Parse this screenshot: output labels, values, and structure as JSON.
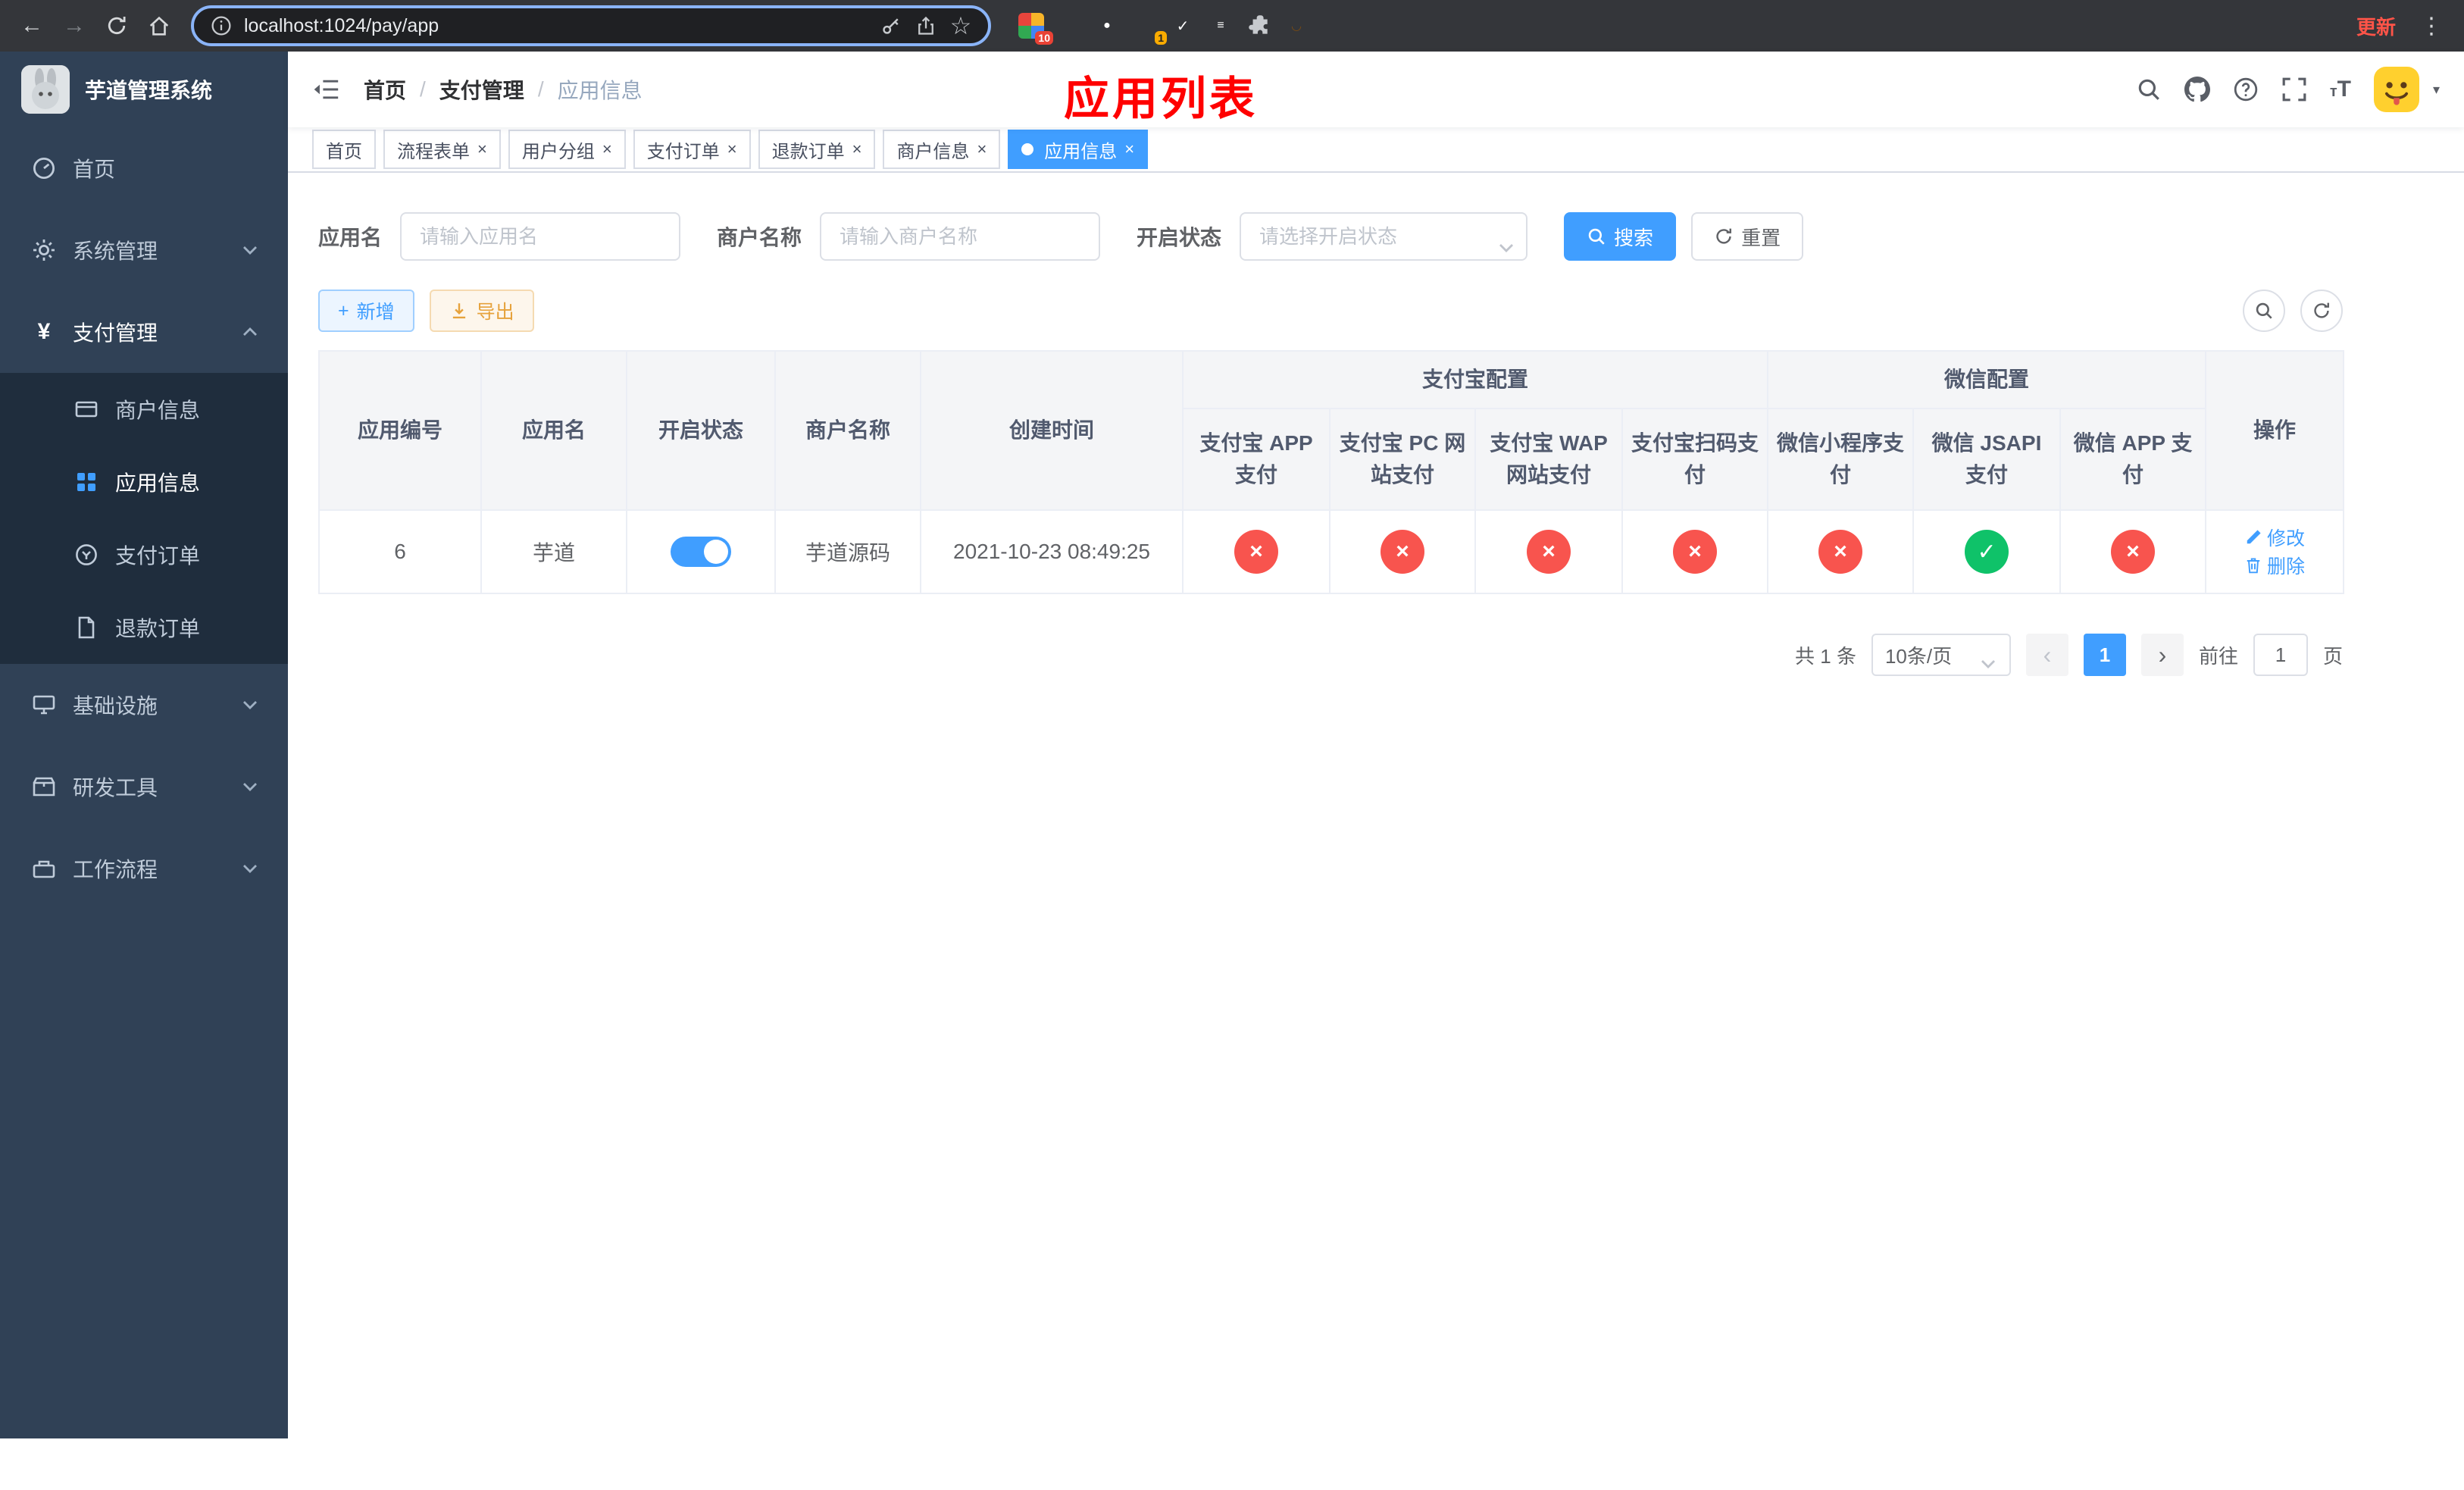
{
  "browser": {
    "url": "localhost:1024/pay/app",
    "update_label": "更新",
    "ext_badge_puzzle": "10",
    "ext_badge_avatar": "1"
  },
  "sidebar": {
    "app_title": "芋道管理系统",
    "items": {
      "home": "首页",
      "system": "系统管理",
      "payment": "支付管理",
      "infra": "基础设施",
      "devtools": "研发工具",
      "workflow": "工作流程"
    },
    "payment_children": {
      "merchant": "商户信息",
      "app": "应用信息",
      "order": "支付订单",
      "refund": "退款订单"
    }
  },
  "header": {
    "breadcrumb": [
      "首页",
      "支付管理",
      "应用信息"
    ],
    "page_overlay_title": "应用列表"
  },
  "tabs": [
    {
      "label": "首页"
    },
    {
      "label": "流程表单"
    },
    {
      "label": "用户分组"
    },
    {
      "label": "支付订单"
    },
    {
      "label": "退款订单"
    },
    {
      "label": "商户信息"
    },
    {
      "label": "应用信息"
    }
  ],
  "filters": {
    "app_name_label": "应用名",
    "app_name_placeholder": "请输入应用名",
    "merchant_label": "商户名称",
    "merchant_placeholder": "请输入商户名称",
    "status_label": "开启状态",
    "status_placeholder": "请选择开启状态",
    "search_button": "搜索",
    "reset_button": "重置"
  },
  "toolbar": {
    "add_button": "新增",
    "export_button": "导出"
  },
  "table": {
    "col_id": "应用编号",
    "col_name": "应用名",
    "col_status": "开启状态",
    "col_merchant": "商户名称",
    "col_created": "创建时间",
    "group_alipay": "支付宝配置",
    "group_wechat": "微信配置",
    "alipay_cols": [
      "支付宝 APP 支付",
      "支付宝 PC 网站支付",
      "支付宝 WAP 网站支付",
      "支付宝扫码支付"
    ],
    "wechat_cols": [
      "微信小程序支付",
      "微信 JSAPI 支付",
      "微信 APP 支付"
    ],
    "col_actions": "操作",
    "action_edit": "修改",
    "action_delete": "删除",
    "rows": [
      {
        "id": "6",
        "name": "芋道",
        "enabled": true,
        "merchant": "芋道源码",
        "created_at": "2021-10-23 08:49:25",
        "pay_statuses": [
          "disabled",
          "disabled",
          "disabled",
          "disabled",
          "disabled",
          "enabled",
          "disabled"
        ]
      }
    ]
  },
  "pagination": {
    "total_text": "共 1 条",
    "page_size": "10条/页",
    "current_page": "1",
    "goto_label": "前往",
    "goto_value": "1",
    "goto_unit": "页"
  },
  "colors": {
    "primary": "#409eff",
    "success": "#0fc269",
    "danger": "#f8544e",
    "warning": "#e6a23c",
    "overlay_title": "#ff0000"
  }
}
